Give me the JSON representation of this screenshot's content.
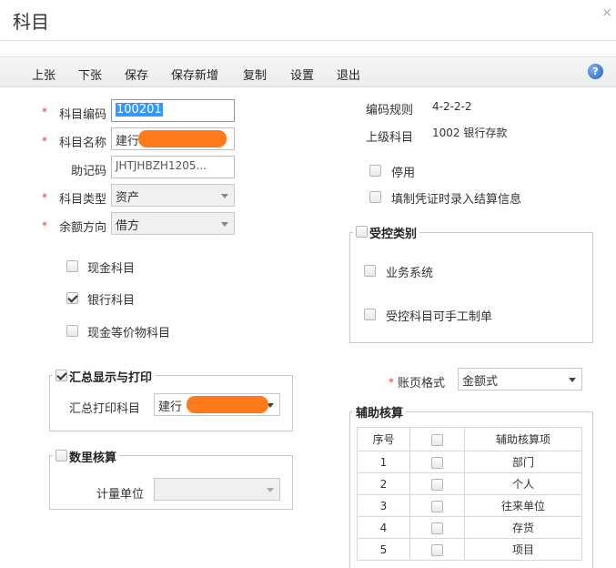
{
  "window": {
    "title": "科目",
    "close_glyph": "×"
  },
  "toolbar": {
    "buttons": [
      "上张",
      "下张",
      "保存",
      "保存新增",
      "复制",
      "设置",
      "退出"
    ],
    "help_icon": "help-icon"
  },
  "form": {
    "code": {
      "label": "科目编码",
      "value": "100201"
    },
    "name": {
      "label": "科目名称",
      "value": "建行"
    },
    "mnemonic": {
      "label": "助记码",
      "value": "JHTJHBZH1205..."
    },
    "type": {
      "label": "科目类型",
      "value": "资产"
    },
    "direction": {
      "label": "余额方向",
      "value": "借方"
    },
    "cash_account": {
      "label": "现金科目",
      "checked": false
    },
    "bank_account": {
      "label": "银行科目",
      "checked": true
    },
    "cash_equiv": {
      "label": "现金等价物科目",
      "checked": false
    }
  },
  "right": {
    "rule_label": "编码规则",
    "rule_value": "4-2-2-2",
    "parent_label": "上级科目",
    "parent_value": "1002 银行存款",
    "disabled": {
      "label": "停用",
      "checked": false
    },
    "settle_info": {
      "label": "填制凭证时录入结算信息",
      "checked": false
    }
  },
  "controlled": {
    "legend": "受控类别",
    "business": {
      "label": "业务系统",
      "checked": false
    },
    "manual": {
      "label": "受控科目可手工制单",
      "checked": false
    }
  },
  "summary": {
    "legend": "汇总显示与打印",
    "checked": true,
    "print_label": "汇总打印科目",
    "print_value": "建行"
  },
  "quantity": {
    "legend": "数里核算",
    "checked": false,
    "unit_label": "计量单位",
    "unit_value": ""
  },
  "ledger": {
    "label": "账页格式",
    "value": "金额式"
  },
  "aux": {
    "legend": "辅助核算",
    "headers": [
      "序号",
      "",
      "辅助核算项"
    ],
    "rows": [
      {
        "no": "1",
        "item": "部门"
      },
      {
        "no": "2",
        "item": "个人"
      },
      {
        "no": "3",
        "item": "往来单位"
      },
      {
        "no": "4",
        "item": "存货"
      },
      {
        "no": "5",
        "item": "项目"
      }
    ]
  },
  "colors": {
    "required": "#e4393c",
    "redact": "#ff7a1a",
    "focus_border": "#6aa0d8",
    "help": "#1f5fc4"
  }
}
